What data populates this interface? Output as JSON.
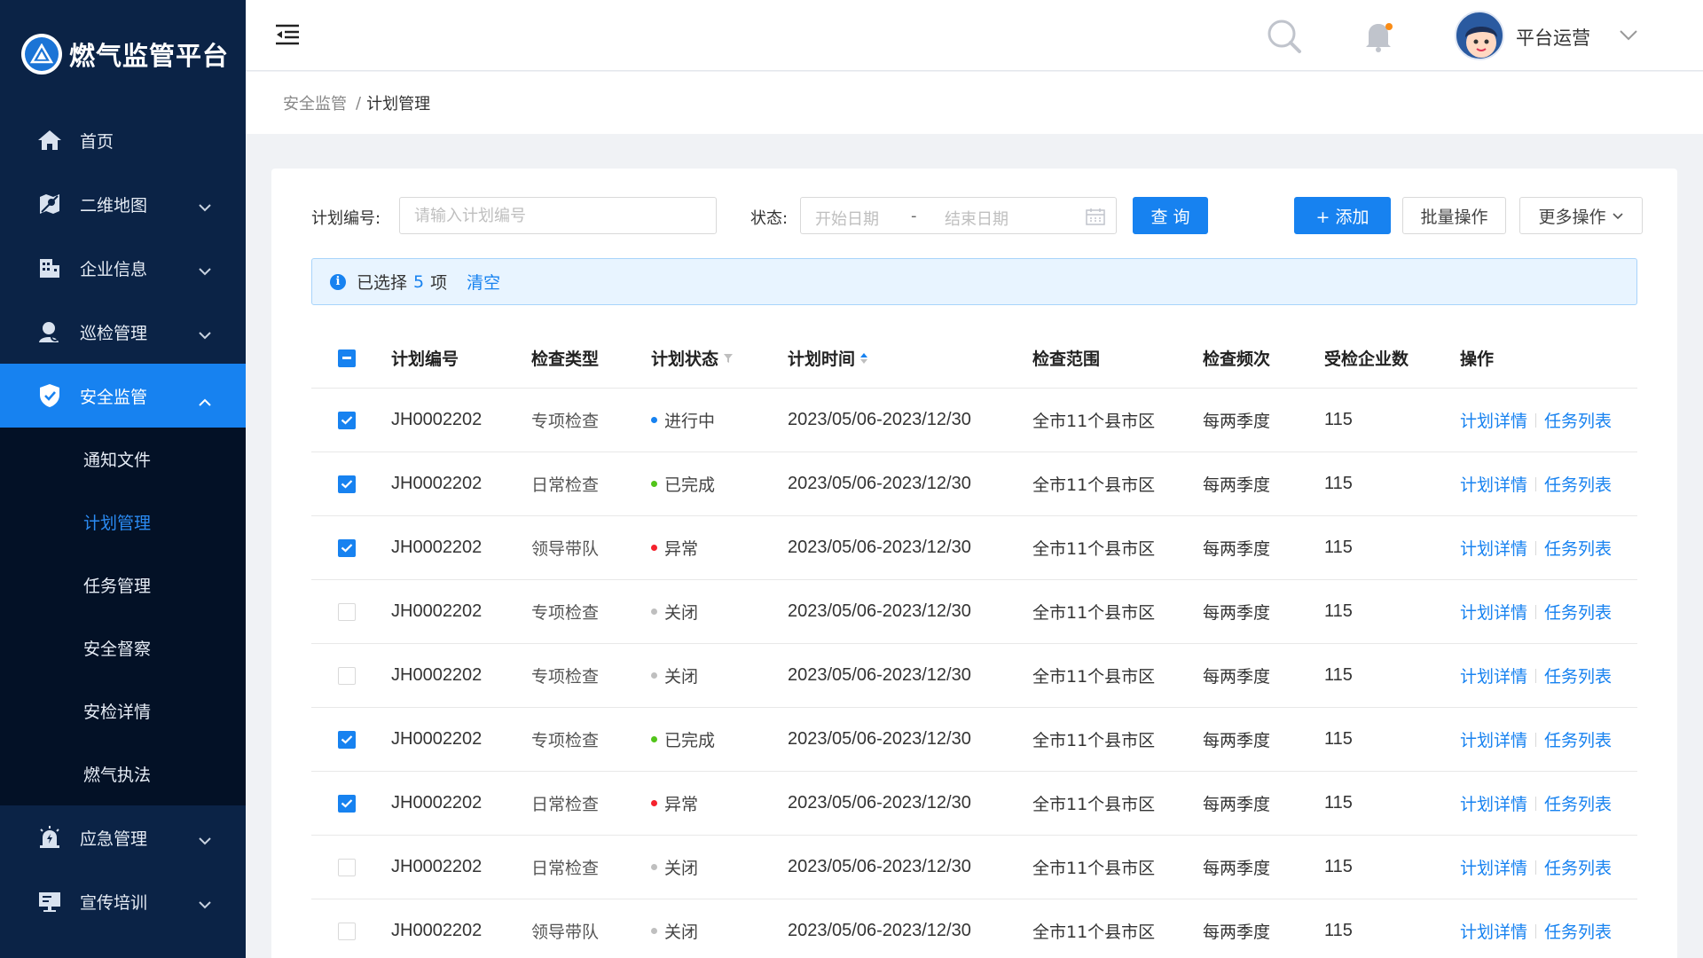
{
  "app": {
    "title": "燃气监管平台"
  },
  "sidebar": {
    "items": [
      {
        "label": "首页",
        "icon": "home-icon"
      },
      {
        "label": "二维地图",
        "icon": "map-icon"
      },
      {
        "label": "企业信息",
        "icon": "building-icon"
      },
      {
        "label": "巡检管理",
        "icon": "inspector-icon"
      },
      {
        "label": "安全监管",
        "icon": "shield-icon"
      },
      {
        "label": "应急管理",
        "icon": "alarm-icon"
      },
      {
        "label": "宣传培训",
        "icon": "training-icon"
      }
    ],
    "sub_items": [
      {
        "label": "通知文件"
      },
      {
        "label": "计划管理"
      },
      {
        "label": "任务管理"
      },
      {
        "label": "安全督察"
      },
      {
        "label": "安检详情"
      },
      {
        "label": "燃气执法"
      }
    ]
  },
  "header": {
    "user_name": "平台运营"
  },
  "breadcrumb": {
    "parent": "安全监管",
    "separator": "/",
    "current": "计划管理"
  },
  "toolbar": {
    "plan_no_label": "计划编号:",
    "plan_no_placeholder": "请输入计划编号",
    "status_label": "状态:",
    "start_placeholder": "开始日期",
    "range_separator": "-",
    "end_placeholder": "结束日期",
    "query_label": "查 询",
    "add_label": "+ 添加",
    "batch_label": "批量操作",
    "more_label": "更多操作"
  },
  "selection": {
    "prefix": "已选择",
    "count": "5",
    "suffix": "项",
    "clear_label": "清空"
  },
  "table": {
    "headers": {
      "plan_no": "计划编号",
      "type": "检查类型",
      "status": "计划状态",
      "time": "计划时间",
      "scope": "检查范围",
      "freq": "检查频次",
      "count": "受检企业数",
      "ops": "操作"
    },
    "detail_label": "计划详情",
    "task_label": "任务列表",
    "rows": [
      {
        "checked": true,
        "plan_no": "JH0002202",
        "type": "专项检查",
        "status": "进行中",
        "status_color": "#1782f0",
        "time": "2023/05/06-2023/12/30",
        "scope": "全市11个县市区",
        "freq": "每两季度",
        "count": "115"
      },
      {
        "checked": true,
        "plan_no": "JH0002202",
        "type": "日常检查",
        "status": "已完成",
        "status_color": "#52c41a",
        "time": "2023/05/06-2023/12/30",
        "scope": "全市11个县市区",
        "freq": "每两季度",
        "count": "115"
      },
      {
        "checked": true,
        "plan_no": "JH0002202",
        "type": "领导带队",
        "status": "异常",
        "status_color": "#f5222d",
        "time": "2023/05/06-2023/12/30",
        "scope": "全市11个县市区",
        "freq": "每两季度",
        "count": "115"
      },
      {
        "checked": false,
        "plan_no": "JH0002202",
        "type": "专项检查",
        "status": "关闭",
        "status_color": "#bfbfbf",
        "time": "2023/05/06-2023/12/30",
        "scope": "全市11个县市区",
        "freq": "每两季度",
        "count": "115"
      },
      {
        "checked": false,
        "plan_no": "JH0002202",
        "type": "专项检查",
        "status": "关闭",
        "status_color": "#bfbfbf",
        "time": "2023/05/06-2023/12/30",
        "scope": "全市11个县市区",
        "freq": "每两季度",
        "count": "115"
      },
      {
        "checked": true,
        "plan_no": "JH0002202",
        "type": "专项检查",
        "status": "已完成",
        "status_color": "#52c41a",
        "time": "2023/05/06-2023/12/30",
        "scope": "全市11个县市区",
        "freq": "每两季度",
        "count": "115"
      },
      {
        "checked": true,
        "plan_no": "JH0002202",
        "type": "日常检查",
        "status": "异常",
        "status_color": "#f5222d",
        "time": "2023/05/06-2023/12/30",
        "scope": "全市11个县市区",
        "freq": "每两季度",
        "count": "115"
      },
      {
        "checked": false,
        "plan_no": "JH0002202",
        "type": "日常检查",
        "status": "关闭",
        "status_color": "#bfbfbf",
        "time": "2023/05/06-2023/12/30",
        "scope": "全市11个县市区",
        "freq": "每两季度",
        "count": "115"
      },
      {
        "checked": false,
        "plan_no": "JH0002202",
        "type": "领导带队",
        "status": "关闭",
        "status_color": "#bfbfbf",
        "time": "2023/05/06-2023/12/30",
        "scope": "全市11个县市区",
        "freq": "每两季度",
        "count": "115"
      }
    ]
  },
  "colors": {
    "sidebar_bg": "#0b2346",
    "submenu_bg": "#031126",
    "accent": "#1782f0"
  }
}
